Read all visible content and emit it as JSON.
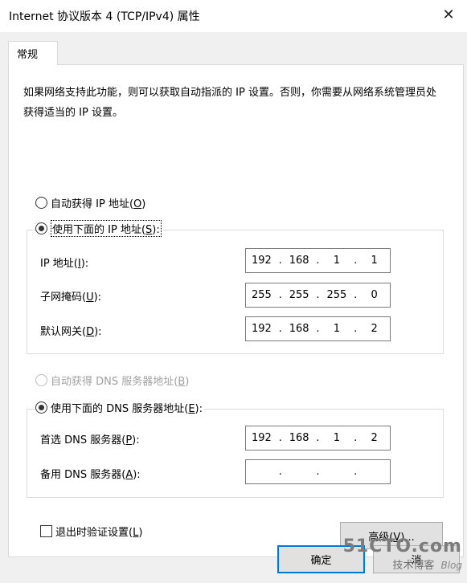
{
  "window": {
    "title": "Internet 协议版本 4 (TCP/IPv4) 属性",
    "close_glyph": "✕"
  },
  "tabs": [
    {
      "label": "常规"
    }
  ],
  "general": {
    "description": "如果网络支持此功能，则可以获取自动指派的 IP 设置。否则，你需要从网络系统管理员处获得适当的 IP 设置。",
    "ip_auto": {
      "label": "自动获得 IP 地址(",
      "key": "O",
      "suffix": ")",
      "selected": false
    },
    "ip_manual": {
      "label": "使用下面的 IP 地址(",
      "key": "S",
      "suffix": "):",
      "selected": true
    },
    "ip_address": {
      "label": "IP 地址(",
      "key": "I",
      "suffix": "):",
      "octets": [
        "192",
        "168",
        "1",
        "1"
      ]
    },
    "subnet_mask": {
      "label": "子网掩码(",
      "key": "U",
      "suffix": "):",
      "octets": [
        "255",
        "255",
        "255",
        "0"
      ]
    },
    "gateway": {
      "label": "默认网关(",
      "key": "D",
      "suffix": "):",
      "octets": [
        "192",
        "168",
        "1",
        "2"
      ]
    },
    "dns_auto": {
      "label": "自动获得 DNS 服务器地址(",
      "key": "B",
      "suffix": ")",
      "selected": false,
      "disabled": true
    },
    "dns_manual": {
      "label": "使用下面的 DNS 服务器地址(",
      "key": "E",
      "suffix": "):",
      "selected": true
    },
    "preferred_dns": {
      "label": "首选 DNS 服务器(",
      "key": "P",
      "suffix": "):",
      "octets": [
        "192",
        "168",
        "1",
        "2"
      ]
    },
    "alternate_dns": {
      "label": "备用 DNS 服务器(",
      "key": "A",
      "suffix": "):",
      "octets": [
        "",
        "",
        "",
        ""
      ]
    },
    "validate_on_exit": {
      "label": "退出时验证设置(",
      "key": "L",
      "suffix": ")",
      "checked": false
    },
    "advanced_button": {
      "label": "高级(",
      "key": "V",
      "suffix": ")..."
    }
  },
  "footer": {
    "ok_label": "确定",
    "cancel_label": "消"
  },
  "watermark": {
    "site": "51CTO.com",
    "tagline": "技术博客",
    "blog": "Blog"
  }
}
